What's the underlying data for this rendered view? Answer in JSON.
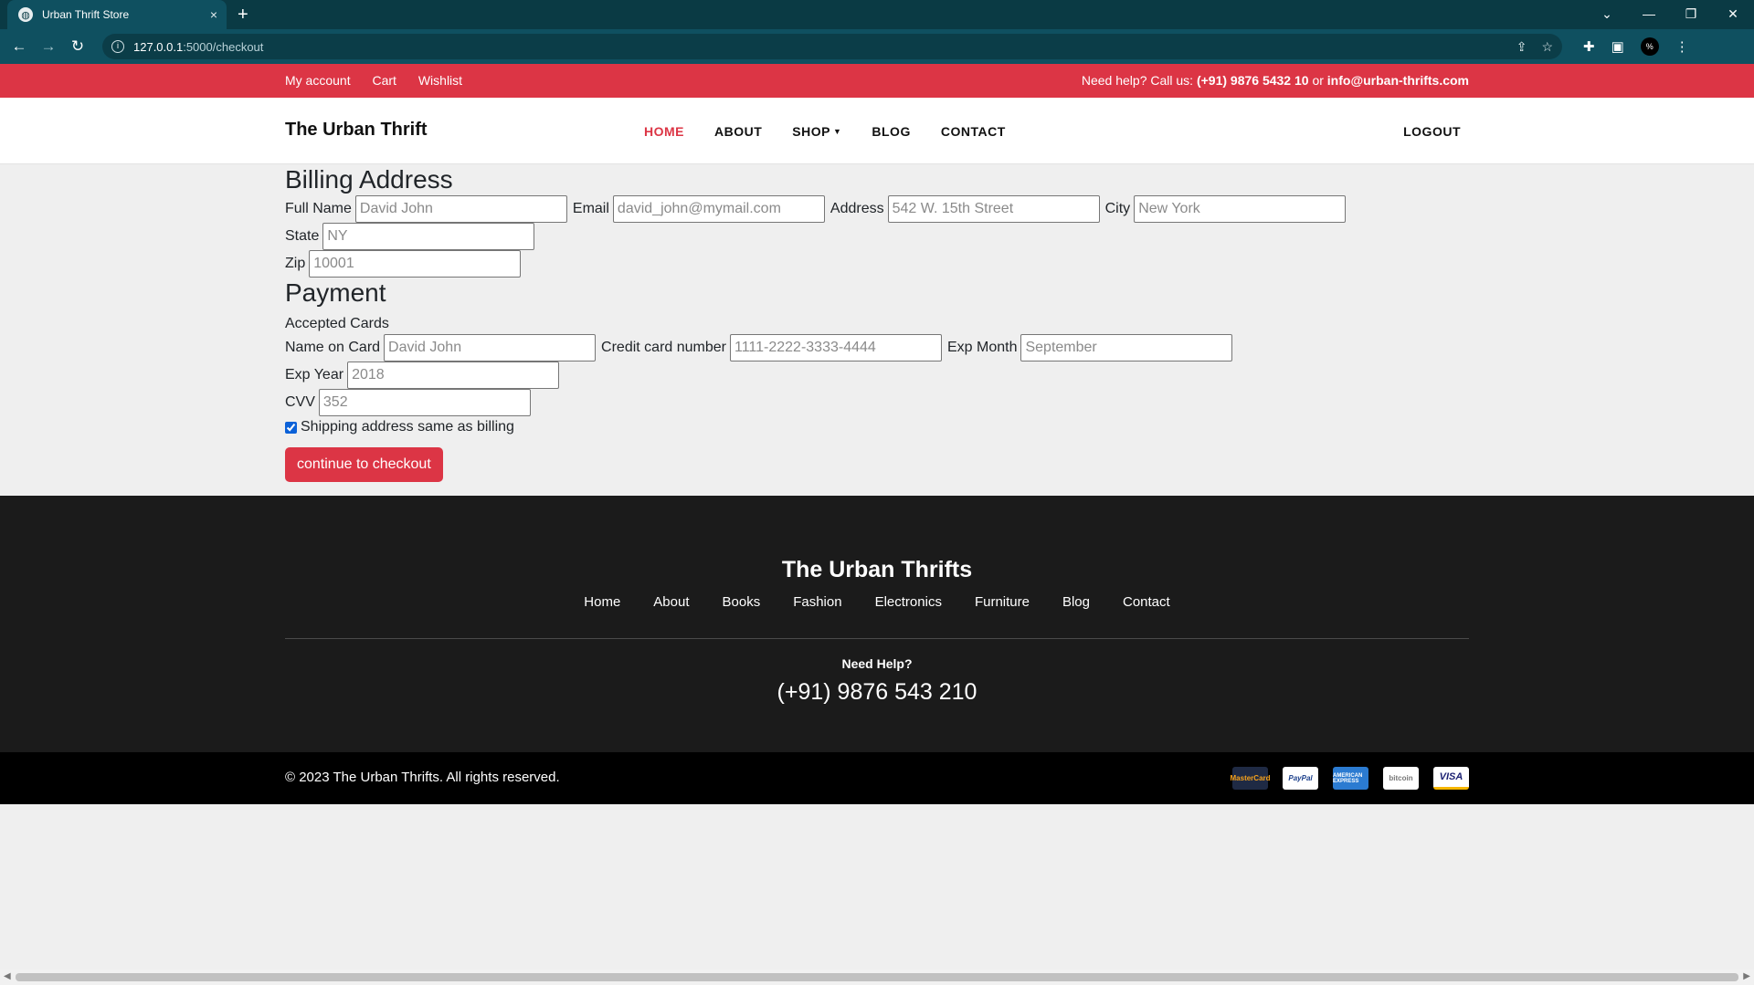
{
  "browser": {
    "tab_title": "Urban Thrift Store",
    "tab_close": "×",
    "new_tab": "+",
    "url_host": "127.0.0.1",
    "url_path": ":5000/checkout",
    "controls": {
      "collapse": "⌄",
      "minimize": "—",
      "restore": "❐",
      "close": "✕"
    }
  },
  "topbar": {
    "links": [
      "My account",
      "Cart",
      "Wishlist"
    ],
    "help_prefix": "Need help? Call us: ",
    "phone": "(+91) 9876 5432 10",
    "or": " or ",
    "email": "info@urban-thrifts.com"
  },
  "navbar": {
    "brand": "The Urban Thrift",
    "menu": [
      "HOME",
      "ABOUT",
      "SHOP",
      "BLOG",
      "CONTACT"
    ],
    "active": "HOME",
    "logout": "LOGOUT"
  },
  "billing": {
    "heading": "Billing Address",
    "full_name": {
      "label": "Full Name",
      "placeholder": "David John"
    },
    "email": {
      "label": "Email",
      "placeholder": "david_john@mymail.com"
    },
    "address": {
      "label": "Address",
      "placeholder": "542 W. 15th Street"
    },
    "city": {
      "label": "City",
      "placeholder": "New York"
    },
    "state": {
      "label": "State",
      "placeholder": "NY"
    },
    "zip": {
      "label": "Zip",
      "placeholder": "10001"
    }
  },
  "payment": {
    "heading": "Payment",
    "accepted_cards": "Accepted Cards",
    "name_on_card": {
      "label": "Name on Card",
      "placeholder": "David John"
    },
    "card_number": {
      "label": "Credit card number",
      "placeholder": "1111-2222-3333-4444"
    },
    "exp_month": {
      "label": "Exp Month",
      "placeholder": "September"
    },
    "exp_year": {
      "label": "Exp Year",
      "placeholder": "2018"
    },
    "cvv": {
      "label": "CVV",
      "placeholder": "352"
    },
    "same_address": {
      "label": "Shipping address same as billing",
      "checked": true
    },
    "submit": "continue to checkout"
  },
  "footer": {
    "brand": "The Urban Thrifts",
    "links": [
      "Home",
      "About",
      "Books",
      "Fashion",
      "Electronics",
      "Furniture",
      "Blog",
      "Contact"
    ],
    "help_title": "Need Help?",
    "phone": "(+91) 9876 543 210",
    "copyright": "© 2023 The Urban Thrifts. All rights reserved.",
    "payment_icons": [
      {
        "name": "mastercard-icon",
        "text": "MasterCard"
      },
      {
        "name": "paypal-icon",
        "text": "PayPal"
      },
      {
        "name": "amex-icon",
        "text": "AMERICAN EXPRESS"
      },
      {
        "name": "bitcoin-icon",
        "text": "bitcoin"
      },
      {
        "name": "visa-icon",
        "text": "VISA"
      }
    ]
  },
  "colors": {
    "accent": "#dc3545",
    "browser": "#0f5060",
    "footer": "#1b1b1b"
  }
}
